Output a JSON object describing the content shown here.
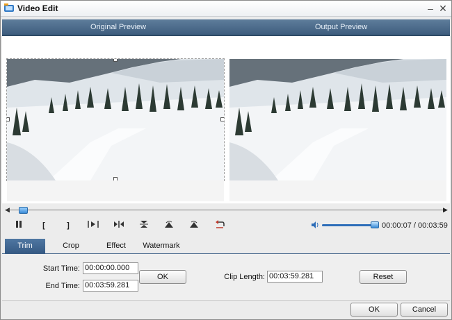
{
  "window": {
    "title": "Video Edit",
    "minimize_icon": "minimize-icon",
    "close_icon": "close-icon"
  },
  "preview": {
    "original_label": "Original Preview",
    "output_label": "Output Preview"
  },
  "timeline": {
    "position_fraction": 0.017
  },
  "controls": {
    "pause_icon": "pause-icon",
    "mark_in_label": "[",
    "mark_out_label": "]",
    "play_segment_icon": "play-segment-icon",
    "split_icon": "split-icon",
    "flip_vertical_icon": "flip-vertical-icon",
    "rotate_left_icon": "rotate-left-icon",
    "rotate_right_icon": "rotate-right-icon",
    "undo_icon": "undo-icon",
    "volume_icon": "volume-icon",
    "volume_fraction": 0.95,
    "time_display": "00:00:07 / 00:03:59"
  },
  "tabs": [
    {
      "label": "Trim",
      "active": true
    },
    {
      "label": "Crop",
      "active": false
    },
    {
      "label": "Effect",
      "active": false
    },
    {
      "label": "Watermark",
      "active": false
    }
  ],
  "trim": {
    "start_label": "Start Time:",
    "start_value": "00:00:00.000",
    "end_label": "End Time:",
    "end_value": "00:03:59.281",
    "ok_label": "OK",
    "clip_length_label": "Clip Length:",
    "clip_length_value": "00:03:59.281",
    "reset_label": "Reset"
  },
  "footer": {
    "ok_label": "OK",
    "cancel_label": "Cancel"
  },
  "colors": {
    "header_blue": "#3e5d7e",
    "accent_blue": "#2d6db8",
    "tab_active": "#365a84"
  }
}
